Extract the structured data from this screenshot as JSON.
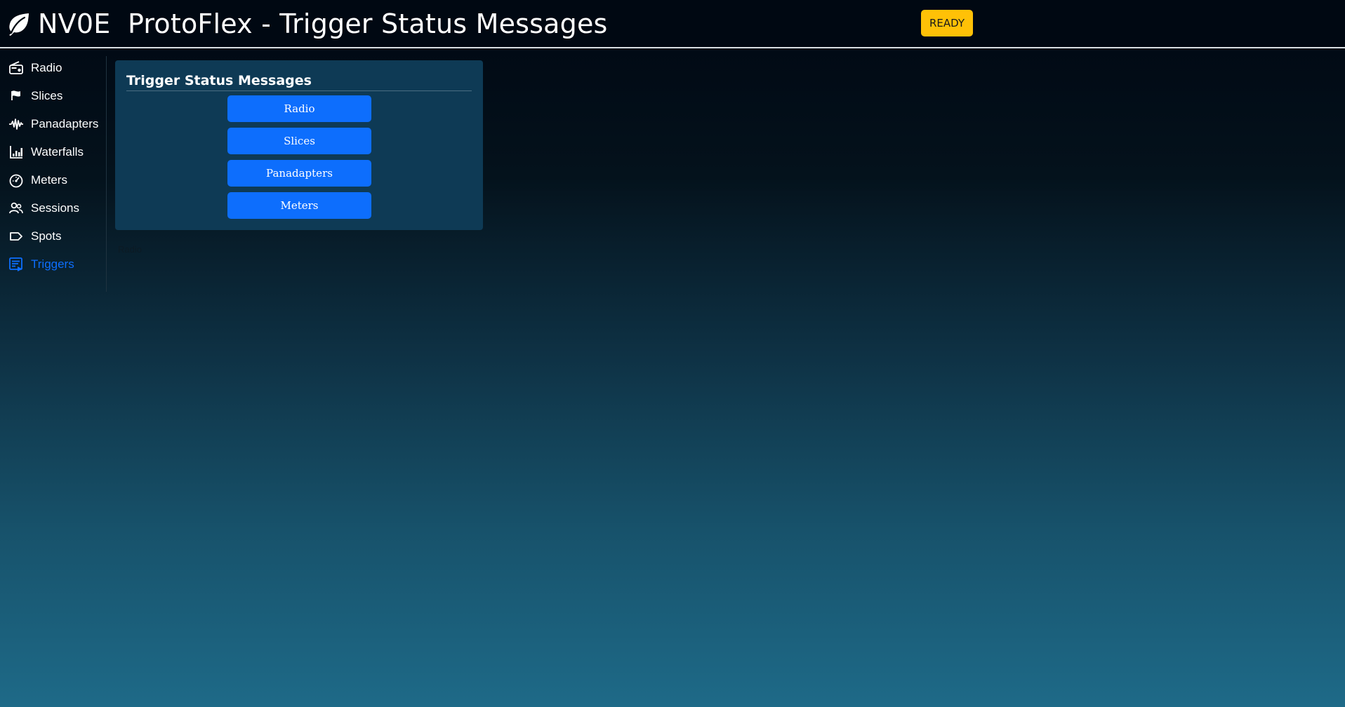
{
  "header": {
    "title": "NV0E  ProtoFlex - Trigger Status Messages",
    "logo_icon": "leaf-icon",
    "status": "READY",
    "status_color": "#ffc107"
  },
  "sidebar": {
    "items": [
      {
        "label": "Radio",
        "icon": "radio-icon",
        "active": false
      },
      {
        "label": "Slices",
        "icon": "flag-icon",
        "active": false
      },
      {
        "label": "Panadapters",
        "icon": "waveform-icon",
        "active": false
      },
      {
        "label": "Waterfalls",
        "icon": "bar-chart-icon",
        "active": false
      },
      {
        "label": "Meters",
        "icon": "speedometer-icon",
        "active": false
      },
      {
        "label": "Sessions",
        "icon": "people-icon",
        "active": false
      },
      {
        "label": "Spots",
        "icon": "tag-icon",
        "active": false
      },
      {
        "label": "Triggers",
        "icon": "trigger-list-icon",
        "active": true
      }
    ],
    "active_color": "#0d6efd"
  },
  "main": {
    "card_title": "Trigger Status Messages",
    "buttons": [
      {
        "label": "Radio"
      },
      {
        "label": "Slices"
      },
      {
        "label": "Panadapters"
      },
      {
        "label": "Meters"
      }
    ],
    "button_color": "#0d6efd",
    "faint_text": "Radio"
  }
}
